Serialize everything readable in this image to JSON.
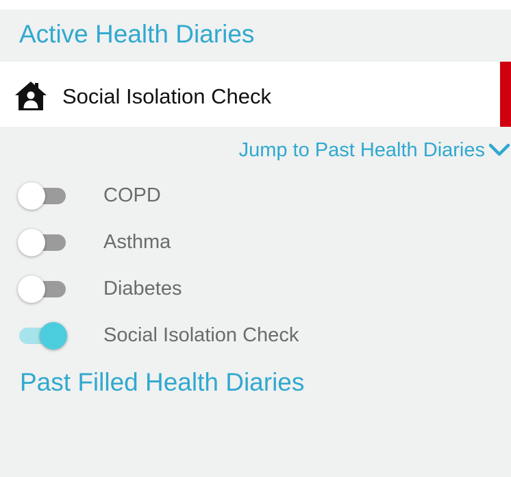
{
  "active_section": {
    "title": "Active Health Diaries"
  },
  "active_diary": {
    "label": "Social Isolation Check",
    "icon": "home-user-icon",
    "accent_color": "#d0000f"
  },
  "jump_link": {
    "label": "Jump to Past Health Diaries",
    "icon": "chevron-down-icon"
  },
  "toggles": [
    {
      "label": "COPD",
      "on": false
    },
    {
      "label": "Asthma",
      "on": false
    },
    {
      "label": "Diabetes",
      "on": false
    },
    {
      "label": "Social Isolation Check",
      "on": true
    }
  ],
  "past_section": {
    "title": "Past Filled Health Diaries"
  },
  "colors": {
    "accent": "#2fa9cf",
    "toggle_on": "#4ccddd",
    "toggle_off": "#9b9b9b",
    "background": "#f0f1f1"
  }
}
